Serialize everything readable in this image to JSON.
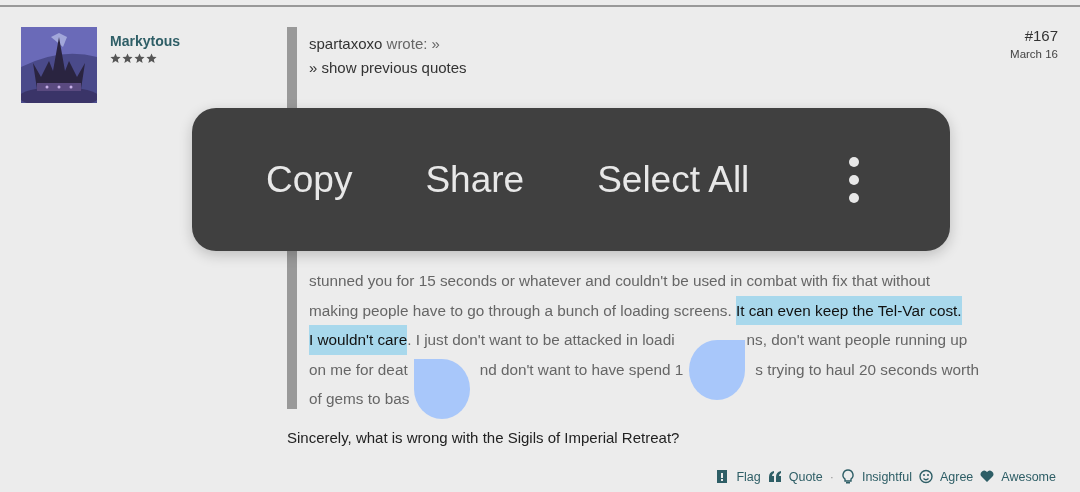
{
  "post": {
    "author": "Markytous",
    "stars": 4,
    "number": "#167",
    "date": "March 16",
    "quote": {
      "author": "spartaxoxo",
      "wrote": "wrote: »",
      "show_previous": "» show previous quotes",
      "lines": [
        [
          [
            {
              "text": "stunned you for 15 seconds or whatever and couldn't be used in combat with fix that without",
              "selected": false
            }
          ]
        ],
        [
          [
            {
              "text": "making people have to go through a bunch of loading screens. ",
              "selected": false
            },
            {
              "text": "It can even keep the Tel-Var cost.",
              "selected": true
            }
          ]
        ],
        [
          [
            {
              "text": "I wouldn't care",
              "selected": true
            },
            {
              "text": ". I just don't want to be attacked in loadi",
              "selected": false
            }
          ],
          [
            {
              "text": "ns, don't want people running up",
              "selected": false
            }
          ]
        ],
        [
          [
            {
              "text": "on me for deat",
              "selected": false
            }
          ],
          [
            {
              "text": "nd don't want to have spend 1",
              "selected": false
            }
          ],
          [
            {
              "text": "s trying to haul 20 seconds worth",
              "selected": false
            }
          ]
        ],
        [
          [
            {
              "text": "of gems to bas",
              "selected": false
            }
          ]
        ]
      ]
    },
    "body": "Sincerely, what is wrong with the Sigils of Imperial Retreat?",
    "actions": [
      {
        "kind": "flag",
        "label": "Flag"
      },
      {
        "kind": "quote",
        "label": "Quote",
        "suffix": "·"
      },
      {
        "kind": "bulb",
        "label": "Insightful"
      },
      {
        "kind": "smile",
        "label": "Agree"
      },
      {
        "kind": "heart",
        "label": "Awesome"
      }
    ]
  },
  "context_menu": {
    "items": [
      "Copy",
      "Share",
      "Select All"
    ]
  }
}
